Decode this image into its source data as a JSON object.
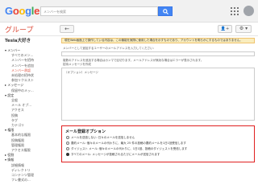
{
  "header": {
    "logo_letters": [
      "G",
      "o",
      "o",
      "g",
      "l",
      "e"
    ],
    "search_placeholder": "メンバーを検索",
    "colors": {
      "search_button": "#4285f4",
      "brand_red": "#dd4b39"
    }
  },
  "subbar": {
    "title": "グループ",
    "back_label": "←",
    "user_label": "👤+",
    "gear_label": "⚙ ▾"
  },
  "sidebar": {
    "group_name": "Tesla大好き",
    "items": [
      {
        "label": "▾ メンバー",
        "kind": "section"
      },
      {
        "label": "すべてのメン...",
        "kind": "item"
      },
      {
        "label": "メンバーを招待",
        "kind": "item"
      },
      {
        "label": "メンバーを追加",
        "kind": "item"
      },
      {
        "label": "メンバー承認",
        "kind": "active"
      },
      {
        "label": "未処理の招待状",
        "kind": "item"
      },
      {
        "label": "参加リクエスト",
        "kind": "item"
      },
      {
        "label": "▸ メッセージ",
        "kind": "section"
      },
      {
        "label": "保留中のメッ...",
        "kind": "item"
      },
      {
        "label": "▾ 設定",
        "kind": "section"
      },
      {
        "label": "全般",
        "kind": "item"
      },
      {
        "label": "メール オプ...",
        "kind": "item"
      },
      {
        "label": "アクセス",
        "kind": "item"
      },
      {
        "label": "投稿",
        "kind": "item"
      },
      {
        "label": "タグ",
        "kind": "item"
      },
      {
        "label": "カテゴリ",
        "kind": "item"
      },
      {
        "label": "▾ 権限",
        "kind": "section"
      },
      {
        "label": "基本的な権限",
        "kind": "item"
      },
      {
        "label": "投稿権限",
        "kind": "item"
      },
      {
        "label": "管理権限",
        "kind": "item"
      },
      {
        "label": "アクセス権限",
        "kind": "item"
      },
      {
        "label": "▸ 役割",
        "kind": "section"
      },
      {
        "label": "▾ 情報",
        "kind": "section"
      },
      {
        "label": "詳細情報",
        "kind": "item"
      },
      {
        "label": "ディレクトリ",
        "kind": "item"
      },
      {
        "label": "コンテンツ管理",
        "kind": "item"
      },
      {
        "label": "フレ書式の...",
        "kind": "item"
      }
    ]
  },
  "main": {
    "notice": "現在Web画面上で操作している内容は、この機能を実際に使用した場合を示すものであり、アカウントを明らかにするものではありません。",
    "field1_label": "メンバーとして追加するユーザーのメールアドレスを入力してください:",
    "field1_note": "複数のアドレスを追加する場合はカンマで区切ります。メールアドレスが無効な場合はエラーが表示されます。",
    "message_label": "招待メッセージを作成",
    "message_placeholder": "（オプション）メッセージ"
  },
  "options": {
    "title": "メール登録オプション",
    "rows": [
      {
        "label": "メールを送信しない: 日々のメールを送信しません",
        "selected": false
      },
      {
        "label": "要約メール: 個々のメールの代わりに、最大 25 件の投稿の要約メールを1日1回受信します",
        "selected": false
      },
      {
        "label": "ダイジェスト メール: 個々のメールの代わりに、1日1回、投稿のダイジェストを受信します",
        "selected": false
      },
      {
        "label": "すべてのメール: メッセージが投稿されるたびにメールが送信されます",
        "selected": true
      }
    ]
  }
}
